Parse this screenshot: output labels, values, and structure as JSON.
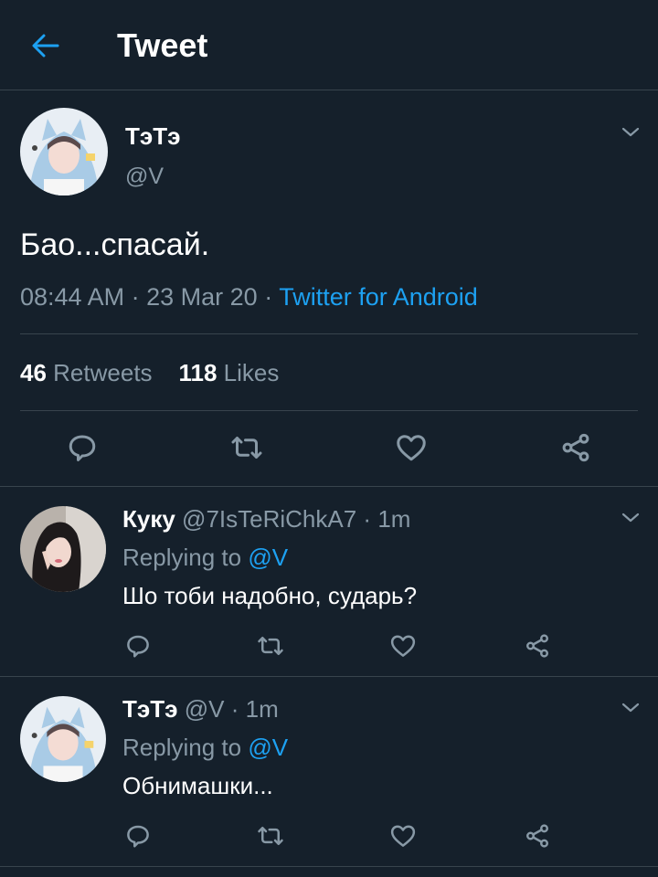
{
  "header": {
    "title": "Tweet"
  },
  "tweet": {
    "name": "ТэТэ",
    "handle": "@V",
    "text": "Бао...спасай.",
    "time": "08:44 AM",
    "date": "23 Mar 20",
    "sep": "·",
    "source": "Twitter for Android",
    "retweets_count": "46",
    "retweets_label": "Retweets",
    "likes_count": "118",
    "likes_label": "Likes"
  },
  "replies": [
    {
      "name": "Куку",
      "handle": "@7IsTeRiChkA7",
      "sep": "·",
      "time": "1m",
      "replying_label": "Replying to",
      "replying_to": "@V",
      "text": "Шо тоби надобно, сударь?"
    },
    {
      "name": "ТэТэ",
      "handle": "@V",
      "sep": "·",
      "time": "1m",
      "replying_label": "Replying to",
      "replying_to": "@V",
      "text": "Обнимашки..."
    }
  ],
  "colors": {
    "background": "#15202b",
    "accent": "#1da1f2",
    "muted": "#8899a6",
    "divider": "#38444d"
  },
  "icons": [
    "back-arrow-icon",
    "chevron-down-icon",
    "reply-icon",
    "retweet-icon",
    "like-icon",
    "share-icon"
  ]
}
